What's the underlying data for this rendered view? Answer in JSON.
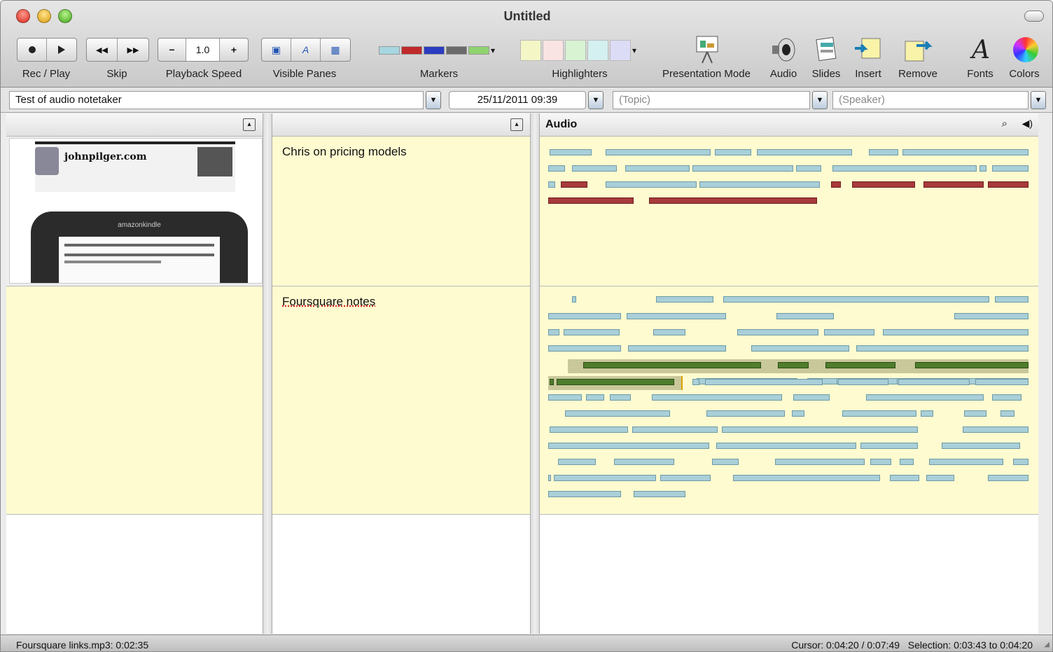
{
  "window": {
    "title": "Untitled"
  },
  "toolbar": {
    "rec_play_label": "Rec / Play",
    "skip_label": "Skip",
    "playback_speed_label": "Playback Speed",
    "playback_speed_value": "1.0",
    "visible_panes_label": "Visible Panes",
    "markers_label": "Markers",
    "highlighters_label": "Highlighters",
    "presentation_mode_label": "Presentation Mode",
    "audio_label": "Audio",
    "slides_label": "Slides",
    "insert_label": "Insert",
    "remove_label": "Remove",
    "fonts_label": "Fonts",
    "colors_label": "Colors",
    "marker_colors": [
      "#a6d6e0",
      "#c02a2a",
      "#2a3cc0",
      "#6a6a6a",
      "#8fd36f"
    ],
    "highlighter_colors": [
      "#f4f6c6",
      "#f9e3e3",
      "#d8f3d2",
      "#d5f0f0",
      "#dcdcf7"
    ]
  },
  "meta": {
    "title_value": "Test of audio notetaker",
    "date_value": "25/11/2011 09:39",
    "topic_placeholder": "(Topic)",
    "speaker_placeholder": "(Speaker)"
  },
  "panes": {
    "audio_header": "Audio",
    "notes": [
      "Chris on pricing models",
      "Foursquare notes"
    ]
  },
  "slide": {
    "site_name": "johnpilger.com",
    "device_name": "amazonkindle"
  },
  "status": {
    "left": "Foursquare links.mp3: 0:02:35",
    "right": "Cursor: 0:04:20 / 0:07:49   Selection: 0:03:43 to 0:04:20"
  }
}
